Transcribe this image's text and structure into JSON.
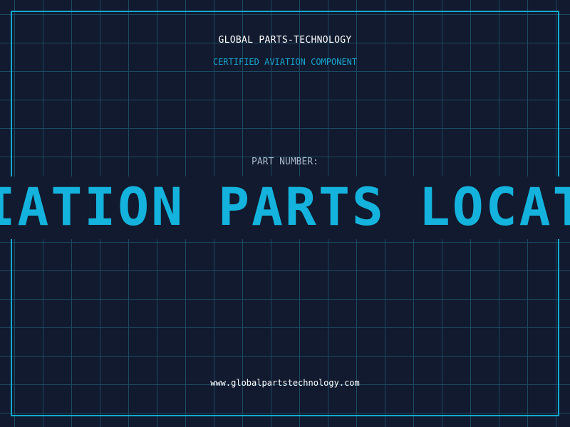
{
  "header": {
    "company": "GLOBAL PARTS-TECHNOLOGY",
    "subtitle": "CERTIFIED AVIATION COMPONENT"
  },
  "part": {
    "label": "PART NUMBER:",
    "value": "AVIATION PARTS LOCATOR"
  },
  "footer": {
    "url": "www.globalpartstechnology.com"
  },
  "colors": {
    "background": "#111a2e",
    "grid": "#1d4a63",
    "accent": "#14b3dd",
    "text": "#ffffff",
    "muted": "#a9b8cc"
  }
}
